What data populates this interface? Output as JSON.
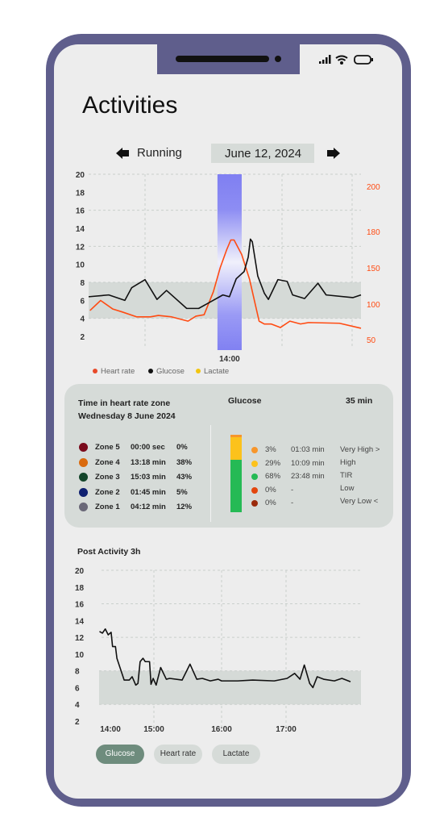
{
  "header": {
    "title": "Activities",
    "activity": "Running",
    "date": "June 12, 2024"
  },
  "colors": {
    "frame": "#5f5e8c",
    "heart_rate": "#ff4b12",
    "glucose": "#111111",
    "lactate": "#f2c511",
    "highlight": "#7f7ff2",
    "range_band": "#d5dad7",
    "button_active": "#6e8c7d"
  },
  "icons": {
    "prev": "arrow-left-icon",
    "next": "arrow-right-icon",
    "status": [
      "signal-icon",
      "wifi-icon",
      "battery-icon"
    ]
  },
  "chart_data": [
    {
      "type": "line",
      "xlabel": "",
      "ylabel": "",
      "x_tick_labels": [
        "14:00"
      ],
      "y_left": {
        "ticks": [
          20,
          18,
          16,
          14,
          12,
          10,
          8,
          6,
          4,
          2
        ],
        "range": [
          2,
          20
        ]
      },
      "y_right": {
        "ticks": [
          200,
          180,
          150,
          100,
          50
        ]
      },
      "target_range": [
        4,
        8
      ],
      "highlight_x": [
        47.3,
        56.2
      ],
      "grid": true,
      "legend": "bottom-left",
      "legend_entries": [
        "Heart rate",
        "Glucose",
        "Lactate"
      ],
      "series": [
        {
          "name": "Glucose",
          "axis": "left",
          "points": [
            [
              0,
              6.4
            ],
            [
              7.4,
              6.6
            ],
            [
              13.3,
              6.0
            ],
            [
              15.8,
              7.4
            ],
            [
              20.7,
              8.3
            ],
            [
              25.1,
              6.1
            ],
            [
              28.6,
              7.1
            ],
            [
              36,
              5.1
            ],
            [
              40.4,
              5.1
            ],
            [
              49.3,
              6.6
            ],
            [
              51.7,
              6.4
            ],
            [
              54.2,
              8.4
            ],
            [
              57.1,
              9.2
            ],
            [
              58.6,
              10.8
            ],
            [
              59.4,
              12.8
            ],
            [
              60.1,
              12.5
            ],
            [
              62.1,
              8.7
            ],
            [
              64.5,
              6.8
            ],
            [
              66,
              6.1
            ],
            [
              69.5,
              8.3
            ],
            [
              72.9,
              8.1
            ],
            [
              74.9,
              6.6
            ],
            [
              79.3,
              6.2
            ],
            [
              84.2,
              7.9
            ],
            [
              87.2,
              6.6
            ],
            [
              97,
              6.3
            ],
            [
              100,
              6.6
            ]
          ]
        },
        {
          "name": "Heart rate",
          "axis": "right",
          "points": [
            [
              0.5,
              91
            ],
            [
              4.4,
              105
            ],
            [
              8.9,
              93
            ],
            [
              12.3,
              89
            ],
            [
              17.7,
              82
            ],
            [
              22.7,
              82
            ],
            [
              25.6,
              84
            ],
            [
              30.5,
              82
            ],
            [
              36.5,
              76
            ],
            [
              39.4,
              83
            ],
            [
              42.4,
              85
            ],
            [
              45.8,
              117
            ],
            [
              48.3,
              150
            ],
            [
              50.7,
              165
            ],
            [
              52.2,
              173
            ],
            [
              53.4,
              173
            ],
            [
              56.2,
              161
            ],
            [
              59.1,
              134
            ],
            [
              61.1,
              101
            ],
            [
              62.6,
              76
            ],
            [
              64.5,
              72
            ],
            [
              67,
              72
            ],
            [
              70.4,
              67
            ],
            [
              73.9,
              76
            ],
            [
              77.8,
              72
            ],
            [
              80.8,
              74
            ],
            [
              92.1,
              73
            ],
            [
              100,
              66
            ]
          ]
        },
        {
          "name": "Lactate",
          "axis": "left",
          "points": []
        }
      ]
    },
    {
      "type": "line",
      "title": "Post Activity 3h",
      "x_unit": "minutes after 14:00",
      "x_ticks": [
        {
          "label": "14:00",
          "value": 0
        },
        {
          "label": "15:00",
          "value": 60
        },
        {
          "label": "16:00",
          "value": 120
        },
        {
          "label": "17:00",
          "value": 180
        }
      ],
      "y_left": {
        "ticks": [
          20,
          18,
          16,
          14,
          12,
          10,
          8,
          6,
          4,
          2
        ],
        "range": [
          2,
          20
        ]
      },
      "target_range": [
        4,
        8
      ],
      "grid": true,
      "series": [
        {
          "name": "Glucose",
          "points": [
            [
              -15,
              12.7
            ],
            [
              -11,
              12.5
            ],
            [
              -7,
              13.0
            ],
            [
              -3,
              12.3
            ],
            [
              1,
              12.6
            ],
            [
              3,
              10.9
            ],
            [
              7,
              10.9
            ],
            [
              9,
              9.5
            ],
            [
              19,
              6.9
            ],
            [
              26,
              6.9
            ],
            [
              30,
              7.3
            ],
            [
              35,
              6.3
            ],
            [
              38,
              6.5
            ],
            [
              41,
              9.1
            ],
            [
              45,
              9.5
            ],
            [
              48,
              9.1
            ],
            [
              54,
              9.1
            ],
            [
              56,
              6.4
            ],
            [
              59,
              7.1
            ],
            [
              62,
              6.3
            ],
            [
              66,
              8.4
            ],
            [
              71,
              7.0
            ],
            [
              74,
              7.1
            ],
            [
              85,
              6.9
            ],
            [
              92,
              8.8
            ],
            [
              98,
              7.0
            ],
            [
              103,
              7.1
            ],
            [
              110,
              6.8
            ],
            [
              117,
              7.0
            ],
            [
              120,
              6.8
            ],
            [
              135,
              6.8
            ],
            [
              149,
              6.9
            ],
            [
              169,
              6.8
            ],
            [
              181,
              7.1
            ],
            [
              188,
              7.7
            ],
            [
              193,
              7.0
            ],
            [
              197,
              8.7
            ],
            [
              202,
              6.5
            ],
            [
              205,
              6.0
            ],
            [
              209,
              7.3
            ],
            [
              215,
              7.0
            ],
            [
              225,
              6.8
            ],
            [
              232,
              7.1
            ],
            [
              240,
              6.7
            ]
          ]
        }
      ]
    }
  ],
  "legend": {
    "heart_rate": "Heart rate",
    "glucose": "Glucose",
    "lactate": "Lactate",
    "x_label": "14:00"
  },
  "zones": {
    "title": "Time in heart rate zone",
    "date": "Wednesday 8 June 2024",
    "items": [
      {
        "name": "Zone 5",
        "time": "00:00 sec",
        "pct": "0%",
        "color": "#7a0a1c"
      },
      {
        "name": "Zone 4",
        "time": "13:18 min",
        "pct": "38%",
        "color": "#d96a0e"
      },
      {
        "name": "Zone 3",
        "time": "15:03 min",
        "pct": "43%",
        "color": "#13452a"
      },
      {
        "name": "Zone 2",
        "time": "01:45 min",
        "pct": "5%",
        "color": "#0f2070"
      },
      {
        "name": "Zone 1",
        "time": "04:12 min",
        "pct": "12%",
        "color": "#6a6878"
      }
    ]
  },
  "glucose": {
    "title": "Glucose",
    "duration": "35 min",
    "items": [
      {
        "pct": "3%",
        "time": "01:03 min",
        "label": "Very High >",
        "color": "#f7962b",
        "fraction": 0.03
      },
      {
        "pct": "29%",
        "time": "10:09 min",
        "label": "High",
        "color": "#fcc21c",
        "fraction": 0.29
      },
      {
        "pct": "68%",
        "time": "23:48 min",
        "label": "TIR",
        "color": "#25ba55",
        "fraction": 0.68
      },
      {
        "pct": "0%",
        "time": "-",
        "label": "Low",
        "color": "#e3460e",
        "fraction": 0
      },
      {
        "pct": "0%",
        "time": "-",
        "label": "Very Low <",
        "color": "#9a2a0c",
        "fraction": 0
      }
    ]
  },
  "post": {
    "title": "Post Activity 3h"
  },
  "buttons": [
    {
      "label": "Glucose",
      "active": true
    },
    {
      "label": "Heart rate",
      "active": false
    },
    {
      "label": "Lactate",
      "active": false
    }
  ]
}
